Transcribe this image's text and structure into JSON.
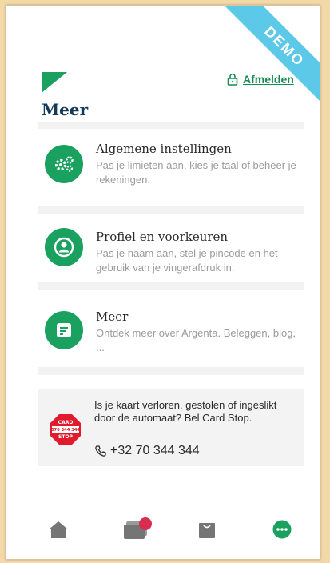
{
  "badge": {
    "demo": "DEMO"
  },
  "header": {
    "logout_label": "Afmelden",
    "page_title": "Meer"
  },
  "menu": {
    "items": [
      {
        "title": "Algemene instellingen",
        "description": "Pas je limieten aan, kies je taal of beheer je rekeningen.",
        "icon": "gears-icon"
      },
      {
        "title": "Profiel en voorkeuren",
        "description": "Pas je naam aan, stel je pincode en het gebruik van je vingerafdruk in.",
        "icon": "profile-icon"
      },
      {
        "title": "Meer",
        "description": "Ontdek meer over Argenta. Beleggen, blog, ...",
        "icon": "document-icon"
      }
    ]
  },
  "card_stop": {
    "message": "Is je kaart verloren, gestolen of ingeslikt door de automaat? Bel Card Stop.",
    "phone": "+32 70 344 344",
    "logo_text_top": "CARD",
    "logo_text_mid": "070 344 344",
    "logo_text_bot": "STOP"
  },
  "tabbar": {
    "tabs": [
      {
        "name": "home",
        "icon": "home-icon"
      },
      {
        "name": "cards",
        "icon": "cards-icon"
      },
      {
        "name": "shop",
        "icon": "shopping-bag-icon"
      },
      {
        "name": "more",
        "icon": "more-dots-icon"
      }
    ]
  },
  "colors": {
    "brand_green": "#1aa160",
    "title_navy": "#12385a",
    "demo_blue": "#5cc9e8",
    "notif_red": "#d82d4f"
  }
}
